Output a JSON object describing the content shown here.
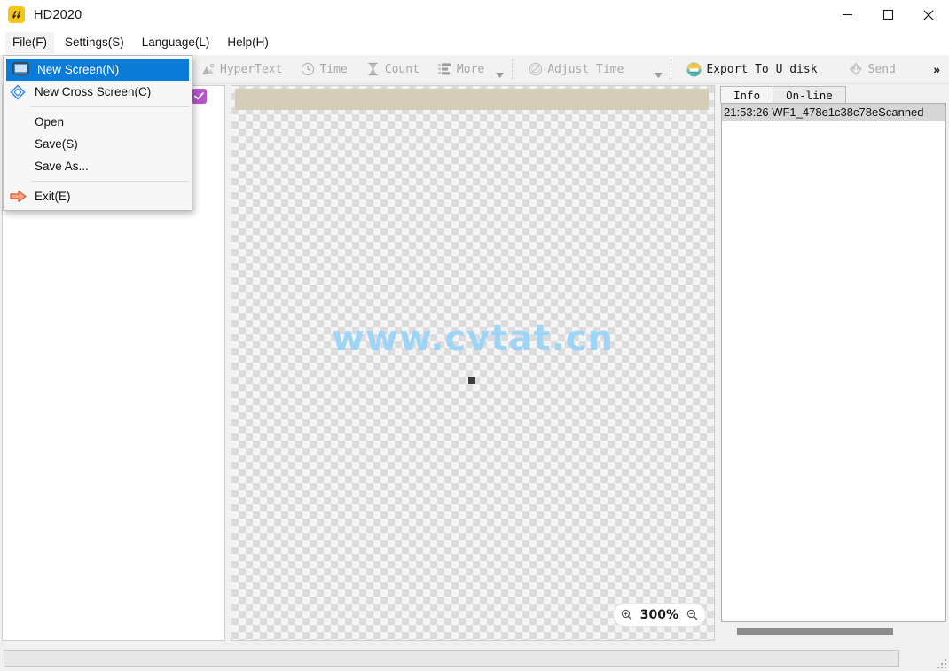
{
  "window": {
    "title": "HD2020",
    "logo_icon": "hd2020-app-icon",
    "controls": {
      "minimize": "minimize-icon",
      "maximize": "maximize-icon",
      "close": "close-icon"
    }
  },
  "menubar": {
    "items": [
      {
        "label": "File(F)",
        "active": true
      },
      {
        "label": "Settings(S)",
        "active": false
      },
      {
        "label": "Language(L)",
        "active": false
      },
      {
        "label": "Help(H)",
        "active": false
      }
    ]
  },
  "file_menu": {
    "open": true,
    "items": [
      {
        "label": "New Screen(N)",
        "icon": "monitor-icon",
        "highlighted": true
      },
      {
        "label": "New Cross Screen(C)",
        "icon": "diamond-icon",
        "highlighted": false
      },
      {
        "separator": true
      },
      {
        "label": "Open",
        "icon": "",
        "highlighted": false
      },
      {
        "label": "Save(S)",
        "icon": "",
        "highlighted": false
      },
      {
        "label": "Save As...",
        "icon": "",
        "highlighted": false
      },
      {
        "separator": true
      },
      {
        "label": "Exit(E)",
        "icon": "exit-arrow-icon",
        "highlighted": false
      }
    ]
  },
  "toolbar": {
    "buttons": [
      {
        "label": "HyperText",
        "icon": "hypertext-icon",
        "enabled": false
      },
      {
        "label": "Time",
        "icon": "clock-icon",
        "enabled": false
      },
      {
        "label": "Count",
        "icon": "hourglass-icon",
        "enabled": false
      },
      {
        "label": "More",
        "icon": "list-icon",
        "enabled": false,
        "caret": true
      },
      {
        "label": "Adjust Time",
        "icon": "adjust-time-icon",
        "enabled": false,
        "caret": true
      },
      {
        "label": "Export To U disk",
        "icon": "usb-export-icon",
        "enabled": true
      },
      {
        "label": "Send",
        "icon": "send-diamond-icon",
        "enabled": false
      }
    ],
    "overflow_label": "»"
  },
  "left_panel": {
    "screen_checkbox_checked": true,
    "checkbox_color": "#b455c8"
  },
  "canvas": {
    "watermark": "www.cvtat.cn",
    "watermark_color": "#9ed4f5",
    "ruler_color": "#d4cdb8",
    "zoom": {
      "value": "300%",
      "zoom_in_icon": "zoom-in-icon",
      "zoom_out_icon": "zoom-out-icon"
    }
  },
  "right_panel": {
    "tabs": [
      {
        "label": "Info",
        "selected": true
      },
      {
        "label": "On-line",
        "selected": false
      }
    ],
    "rows": [
      {
        "text": "21:53:26 WF1_478e1c38c78eScanned",
        "selected": true
      }
    ]
  },
  "statusbar": {
    "text": ""
  }
}
